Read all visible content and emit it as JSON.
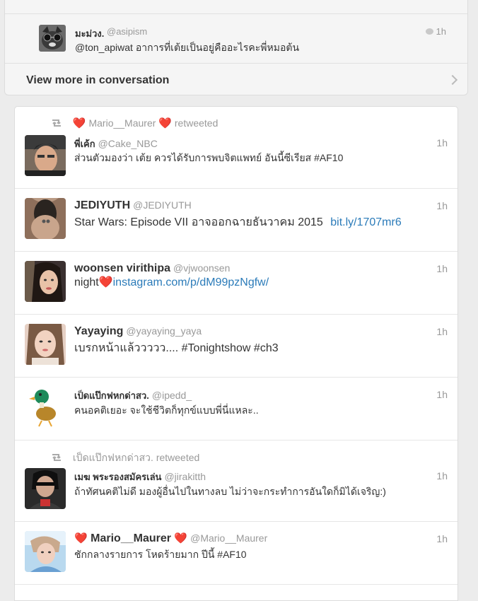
{
  "conversation": {
    "reply": {
      "name": "มะม่วง.",
      "handle": "@asipism",
      "time": "1h",
      "text": "@ton_apiwat อาการที่เต้ยเป็นอยู่คืออะไรคะพี่หมอต้น"
    },
    "view_more_label": "View more in conversation"
  },
  "timeline": {
    "retweet_header_1": {
      "heart_left": "❤️",
      "name": "Mario__Maurer",
      "heart_right": "❤️",
      "suffix": "retweeted"
    },
    "tweets": [
      {
        "name": "พี่เค้ก",
        "handle": "@Cake_NBC",
        "time": "1h",
        "text": "ส่วนตัวมองว่า เต้ย ควรได้รับการพบจิตแพทย์ อันนี้ซีเรียส #AF10"
      },
      {
        "name": "JEDIYUTH",
        "handle": "@JEDIYUTH",
        "time": "1h",
        "text": "Star Wars: Episode VII อาจออกฉายธันวาคม 2015",
        "link": "bit.ly/1707mr6"
      },
      {
        "name": "woonsen virithipa",
        "handle": "@vjwoonsen",
        "time": "1h",
        "text": "night❤️",
        "link": "instagram.com/p/dM99pzNgfw/"
      },
      {
        "name": "Yayaying",
        "handle": "@yayaying_yaya",
        "time": "1h",
        "text": "เบรกหน้าแล้ววววว.... #Tonightshow #ch3"
      },
      {
        "name": "เป็ดแป๊กฟหกด่าสว.",
        "handle": "@ipedd_",
        "time": "1h",
        "text": "คนอคติเยอะ จะใช้ชีวิตก็ทุกข์แบบพี่นี่แหละ.."
      },
      {
        "name": "เมฆ พระรองสมัครเล่น",
        "handle": "@jirakitth",
        "time": "1h",
        "text": "ถ้าทัศนคติไม่ดี มองผู้อื่นไปในทางลบ ไม่ว่าจะกระทำการอันใดก็มิได้เจริญ:)"
      },
      {
        "name_heart_left": "❤️",
        "name": "Mario__Maurer",
        "name_heart_right": "❤️",
        "handle": "@Mario__Maurer",
        "time": "1h",
        "text": "ชักกลางรายการ โหดร้ายมาก ปีนี้ #AF10"
      }
    ],
    "retweet_header_2": {
      "name": "เป็ดแป๊กฟหกด่าสว.",
      "suffix": "retweeted"
    }
  },
  "colors": {
    "background": "#ececec",
    "card": "#ffffff",
    "link": "#2b7bb9",
    "muted": "#999999",
    "heart": "#d42424"
  },
  "icons": [
    "retweet-icon",
    "reply-bubble-icon",
    "chevron-right-icon",
    "heart-icon"
  ]
}
